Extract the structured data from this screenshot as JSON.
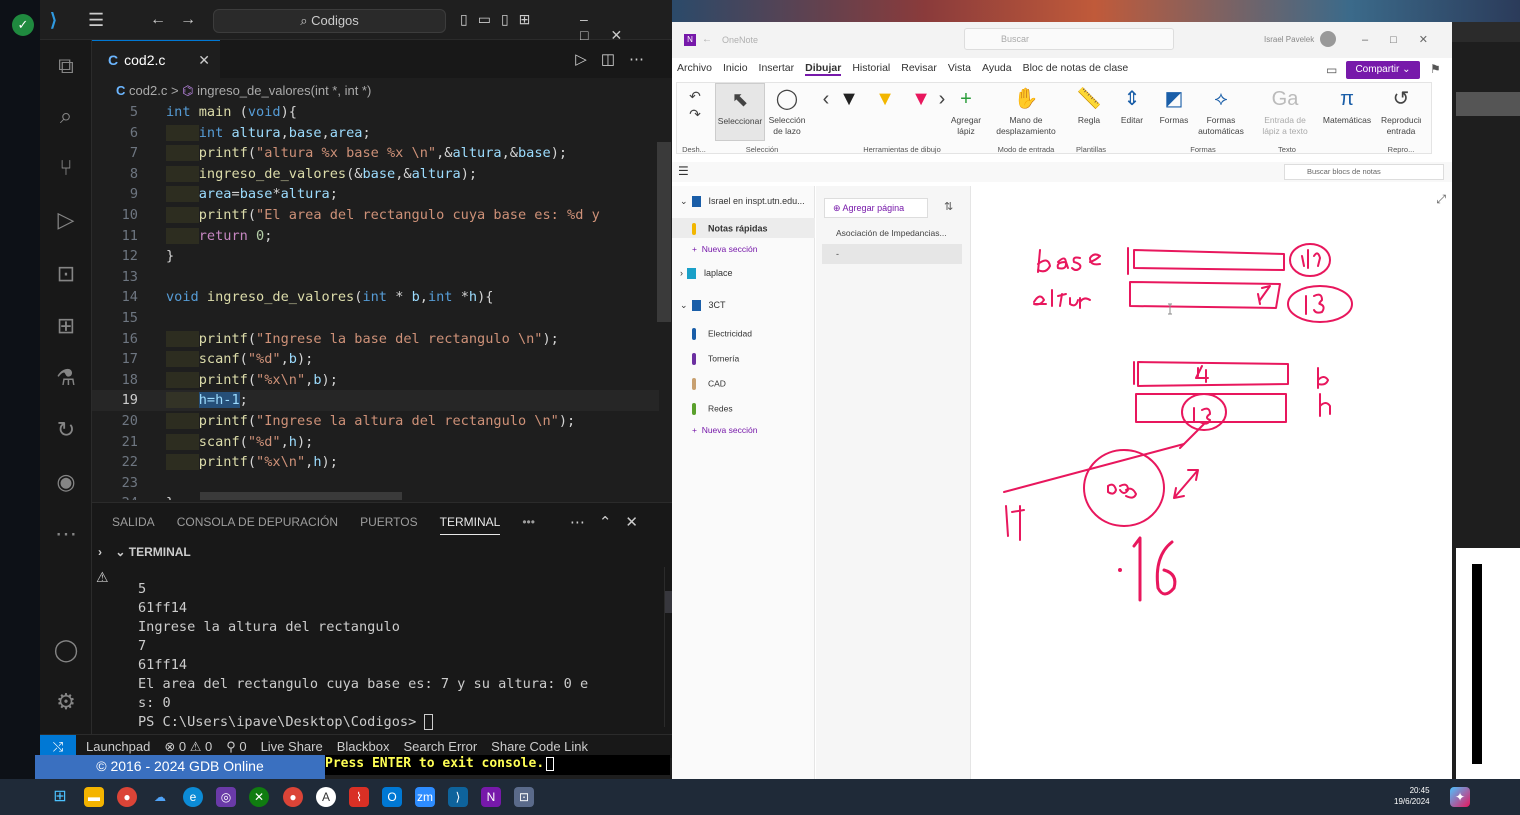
{
  "vscode": {
    "search_text": "Codigos",
    "tab": {
      "icon_label": "C",
      "filename": "cod2.c",
      "close": "✕"
    },
    "breadcrumb": {
      "icon_label": "C",
      "file": "cod2.c",
      "separator": ">",
      "symbol": "ingreso_de_valores(int *, int *)"
    },
    "code_lines": [
      {
        "n": "5",
        "parts": [
          [
            "kw",
            "int "
          ],
          [
            "fn",
            "main "
          ],
          [
            "txt",
            "("
          ],
          [
            "kw",
            "void"
          ],
          [
            "txt",
            "){"
          ]
        ]
      },
      {
        "n": "6",
        "parts": [
          [
            "pad",
            "    "
          ],
          [
            "kw",
            "int "
          ],
          [
            "var",
            "altura"
          ],
          [
            "txt",
            ","
          ],
          [
            "var",
            "base"
          ],
          [
            "txt",
            ","
          ],
          [
            "var",
            "area"
          ],
          [
            "txt",
            ";"
          ]
        ]
      },
      {
        "n": "7",
        "parts": [
          [
            "pad",
            "    "
          ],
          [
            "fn",
            "printf"
          ],
          [
            "txt",
            "("
          ],
          [
            "str",
            "\"altura %x base %x \\n\""
          ],
          [
            "txt",
            ",&"
          ],
          [
            "var",
            "altura"
          ],
          [
            "txt",
            ",&"
          ],
          [
            "var",
            "base"
          ],
          [
            "txt",
            ");"
          ]
        ]
      },
      {
        "n": "8",
        "parts": [
          [
            "pad",
            "    "
          ],
          [
            "fn",
            "ingreso_de_valores"
          ],
          [
            "txt",
            "(&"
          ],
          [
            "var",
            "base"
          ],
          [
            "txt",
            ",&"
          ],
          [
            "var",
            "altura"
          ],
          [
            "txt",
            ");"
          ]
        ]
      },
      {
        "n": "9",
        "parts": [
          [
            "pad",
            "    "
          ],
          [
            "var",
            "area"
          ],
          [
            "txt",
            "="
          ],
          [
            "var",
            "base"
          ],
          [
            "txt",
            "*"
          ],
          [
            "var",
            "altura"
          ],
          [
            "txt",
            ";"
          ]
        ]
      },
      {
        "n": "10",
        "parts": [
          [
            "pad",
            "    "
          ],
          [
            "fn",
            "printf"
          ],
          [
            "txt",
            "("
          ],
          [
            "str",
            "\"El area del rectangulo cuya base es: %d y"
          ]
        ]
      },
      {
        "n": "11",
        "parts": [
          [
            "pad",
            "    "
          ],
          [
            "ctl",
            "return "
          ],
          [
            "num",
            "0"
          ],
          [
            "txt",
            ";"
          ]
        ]
      },
      {
        "n": "12",
        "parts": [
          [
            "txt",
            "}"
          ]
        ]
      },
      {
        "n": "13",
        "parts": []
      },
      {
        "n": "14",
        "parts": [
          [
            "kw",
            "void "
          ],
          [
            "fn",
            "ingreso_de_valores"
          ],
          [
            "txt",
            "("
          ],
          [
            "kw",
            "int "
          ],
          [
            "txt",
            "* "
          ],
          [
            "var",
            "b"
          ],
          [
            "txt",
            ","
          ],
          [
            "kw",
            "int "
          ],
          [
            "txt",
            "*"
          ],
          [
            "var",
            "h"
          ],
          [
            "txt",
            "){"
          ]
        ]
      },
      {
        "n": "15",
        "parts": []
      },
      {
        "n": "16",
        "parts": [
          [
            "pad",
            "    "
          ],
          [
            "fn",
            "printf"
          ],
          [
            "txt",
            "("
          ],
          [
            "str",
            "\"Ingrese la base del rectangulo \\n\""
          ],
          [
            "txt",
            ");"
          ]
        ]
      },
      {
        "n": "17",
        "parts": [
          [
            "pad",
            "    "
          ],
          [
            "fn",
            "scanf"
          ],
          [
            "txt",
            "("
          ],
          [
            "str",
            "\"%d\""
          ],
          [
            "txt",
            ","
          ],
          [
            "var",
            "b"
          ],
          [
            "txt",
            ");"
          ]
        ]
      },
      {
        "n": "18",
        "parts": [
          [
            "pad",
            "    "
          ],
          [
            "fn",
            "printf"
          ],
          [
            "txt",
            "("
          ],
          [
            "str",
            "\"%x\\n\""
          ],
          [
            "txt",
            ","
          ],
          [
            "var",
            "b"
          ],
          [
            "txt",
            ");"
          ]
        ]
      },
      {
        "n": "19",
        "parts": [
          [
            "pad",
            "    "
          ],
          [
            "sel",
            "h=h-1"
          ],
          [
            "txt",
            ";"
          ]
        ]
      },
      {
        "n": "20",
        "parts": [
          [
            "pad",
            "    "
          ],
          [
            "fn",
            "printf"
          ],
          [
            "txt",
            "("
          ],
          [
            "str",
            "\"Ingrese la altura del rectangulo \\n\""
          ],
          [
            "txt",
            ");"
          ]
        ]
      },
      {
        "n": "21",
        "parts": [
          [
            "pad",
            "    "
          ],
          [
            "fn",
            "scanf"
          ],
          [
            "txt",
            "("
          ],
          [
            "str",
            "\"%d\""
          ],
          [
            "txt",
            ","
          ],
          [
            "var",
            "h"
          ],
          [
            "txt",
            ");"
          ]
        ]
      },
      {
        "n": "22",
        "parts": [
          [
            "pad",
            "    "
          ],
          [
            "fn",
            "printf"
          ],
          [
            "txt",
            "("
          ],
          [
            "str",
            "\"%x\\n\""
          ],
          [
            "txt",
            ","
          ],
          [
            "var",
            "h"
          ],
          [
            "txt",
            ");"
          ]
        ]
      },
      {
        "n": "23",
        "parts": []
      },
      {
        "n": "24",
        "parts": [
          [
            "txt",
            "}"
          ]
        ]
      }
    ],
    "current_line": "19",
    "panel_tabs": [
      "SALIDA",
      "CONSOLA DE DEPURACIÓN",
      "PUERTOS",
      "TERMINAL"
    ],
    "active_panel_tab": "TERMINAL",
    "terminal_header": "TERMINAL",
    "terminal_lines": [
      "5",
      "61ff14",
      "Ingrese la altura del rectangulo",
      "7",
      "61ff14",
      "El area del rectangulo cuya base es: 7 y su altura: 0 e",
      "s: 0",
      "PS C:\\Users\\ipave\\Desktop\\Codigos> "
    ],
    "status_items": [
      "Launchpad",
      "⊗ 0 ⚠ 0",
      "⚲ 0",
      "Live Share",
      "Blackbox",
      "Search Error",
      "Share Code Link"
    ],
    "notification_badge": "1"
  },
  "gdb": {
    "footer": "© 2016 - 2024 GDB Online",
    "prompt": "Press ENTER to exit console."
  },
  "onenote": {
    "app_name": "OneNote",
    "search_placeholder": "Buscar",
    "user_name": "Israel Pavelek",
    "menu": [
      "Archivo",
      "Inicio",
      "Insertar",
      "Dibujar",
      "Historial",
      "Revisar",
      "Vista",
      "Ayuda",
      "Bloc de notas de clase"
    ],
    "active_menu": "Dibujar",
    "share_label": "Compartir",
    "ribbon_buttons": [
      "Seleccionar",
      "Selección de lazo",
      "Agregar lápiz",
      "Mano de desplazamiento",
      "Regla",
      "Editar",
      "Formas",
      "Formas automáticas",
      "Entrada de lápiz a texto",
      "Matemáticas",
      "Reproducir entrada"
    ],
    "ribbon_groups": [
      "Desh...",
      "Selección",
      "Herramientas de dibujo",
      "Modo de entrada",
      "Plantillas",
      "Formas",
      "Texto",
      "Repro..."
    ],
    "notebook_search": "Buscar blocs de notas",
    "notebooks": {
      "account": "Israel en inspt.utn.edu...",
      "quick_notes": "Notas rápidas",
      "new_section": "Nueva sección",
      "laplace": "laplace",
      "group_3ct": "3CT",
      "sections": [
        {
          "name": "Electricidad",
          "color": "#1a5ea8"
        },
        {
          "name": "Tornería",
          "color": "#6b2fa0"
        },
        {
          "name": "CAD",
          "color": "#c8a070"
        },
        {
          "name": "Redes",
          "color": "#5aa02c"
        }
      ],
      "new_section2": "Nueva sección"
    },
    "pages": {
      "add_page": "Agregar página",
      "items": [
        "Asociación de Impedancias...",
        "-"
      ]
    },
    "ink_color": "#e8175d"
  },
  "taskbar": {
    "time": "20:45",
    "date": "19/6/2024"
  }
}
